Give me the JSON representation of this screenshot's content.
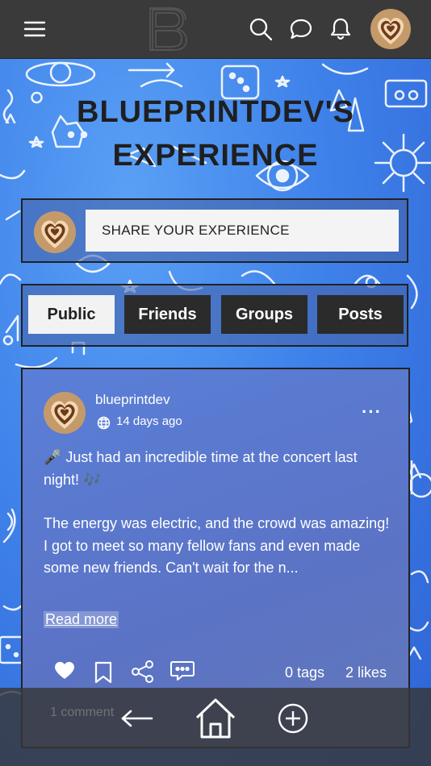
{
  "header": {
    "menu_icon": "hamburger-menu-icon",
    "logo_icon": "b-logo-icon",
    "search_icon": "search-icon",
    "chat_icon": "chat-bubble-icon",
    "notification_icon": "bell-icon",
    "avatar_icon": "heart-avatar-icon"
  },
  "page": {
    "title_line1": "BLUEPRINTDEV'S",
    "title_line2": "EXPERIENCE"
  },
  "share": {
    "placeholder": "SHARE YOUR EXPERIENCE"
  },
  "tabs": [
    {
      "label": "Public",
      "active": true
    },
    {
      "label": "Friends",
      "active": false
    },
    {
      "label": "Groups",
      "active": false
    },
    {
      "label": "Posts",
      "active": false
    }
  ],
  "post": {
    "username": "blueprintdev",
    "time": "14 days ago",
    "line1": "🎤 Just had an incredible time at the concert last night! 🎶",
    "line2": "The energy was electric, and the crowd was amazing! I got to meet so many fellow fans and even made some new friends. Can't wait for the n...",
    "read_more": "Read more",
    "tags": "0 tags",
    "likes": "2 likes",
    "comments": "1 comment",
    "more_label": "···"
  },
  "colors": {
    "accent_bg": "#3f82ea",
    "topbar": "#3a3a3a",
    "tab_dark": "#2b2b2b",
    "tab_light": "#f2f2f2"
  }
}
